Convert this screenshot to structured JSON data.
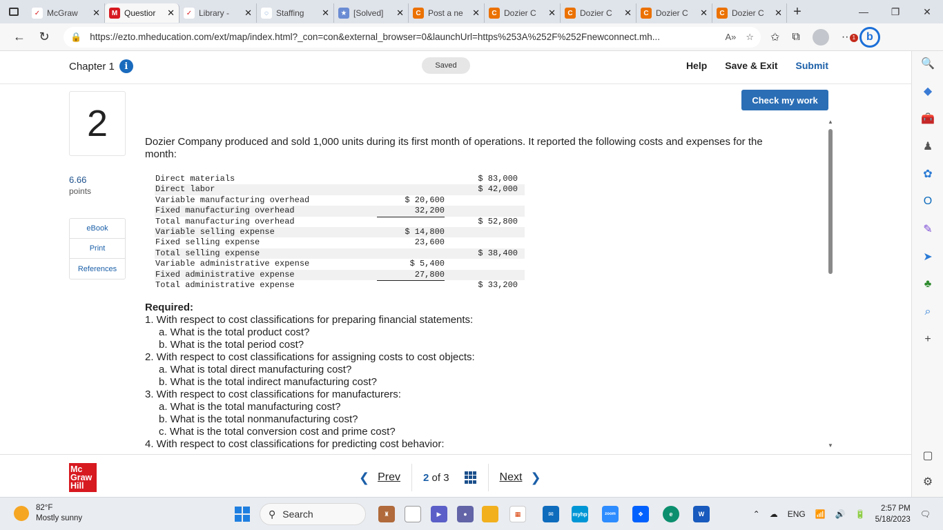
{
  "browser": {
    "tabs": [
      {
        "label": "McGraw",
        "favicon": "mcgraw-bird-icon",
        "active": false
      },
      {
        "label": "Questior",
        "favicon": "mheducation-m-icon",
        "active": true
      },
      {
        "label": "Library -",
        "favicon": "mcgraw-bird-icon",
        "active": false
      },
      {
        "label": "Staffing",
        "favicon": "loading-icon",
        "active": false
      },
      {
        "label": "[Solved]",
        "favicon": "star-icon",
        "active": false
      },
      {
        "label": "Post a ne",
        "favicon": "chegg-c-icon",
        "active": false
      },
      {
        "label": "Dozier C",
        "favicon": "chegg-c-icon",
        "active": false
      },
      {
        "label": "Dozier C",
        "favicon": "chegg-c-icon",
        "active": false
      },
      {
        "label": "Dozier C",
        "favicon": "chegg-c-icon",
        "active": false
      },
      {
        "label": "Dozier C",
        "favicon": "chegg-c-icon",
        "active": false
      }
    ],
    "url": "https://ezto.mheducation.com/ext/map/index.html?_con=con&external_browser=0&launchUrl=https%253A%252F%252Fnewconnect.mh...",
    "notification_count": "1"
  },
  "header": {
    "chapter": "Chapter 1",
    "saved": "Saved",
    "help": "Help",
    "save_exit": "Save & Exit",
    "submit": "Submit"
  },
  "question": {
    "number": "2",
    "points_value": "6.66",
    "points_label": "points",
    "side_buttons": [
      "eBook",
      "Print",
      "References"
    ],
    "check_button": "Check my work",
    "prompt": "Dozier Company produced and sold 1,000 units during its first month of operations. It reported the following costs and expenses for the month:",
    "cost_table": [
      {
        "label": "Direct materials",
        "c1": "",
        "c2": "$ 83,000",
        "ul": false
      },
      {
        "label": "Direct labor",
        "c1": "",
        "c2": "$ 42,000",
        "ul": false
      },
      {
        "label": "Variable manufacturing overhead",
        "c1": "$ 20,600",
        "c2": "",
        "ul": false
      },
      {
        "label": "Fixed manufacturing overhead",
        "c1": "32,200",
        "c2": "",
        "ul": true
      },
      {
        "label": "Total manufacturing overhead",
        "c1": "",
        "c2": "$ 52,800",
        "ul": false
      },
      {
        "label": "Variable selling expense",
        "c1": "$ 14,800",
        "c2": "",
        "ul": false
      },
      {
        "label": "Fixed selling expense",
        "c1": "23,600",
        "c2": "",
        "ul": true
      },
      {
        "label": "Total selling expense",
        "c1": "",
        "c2": "$ 38,400",
        "ul": false
      },
      {
        "label": "Variable administrative expense",
        "c1": "$ 5,400",
        "c2": "",
        "ul": false
      },
      {
        "label": "Fixed administrative expense",
        "c1": "27,800",
        "c2": "",
        "ul": true
      },
      {
        "label": "Total administrative expense",
        "c1": "",
        "c2": "$ 33,200",
        "ul": false
      }
    ],
    "required_title": "Required:",
    "required": [
      {
        "text": "1. With respect to cost classifications for preparing financial statements:",
        "level": 1
      },
      {
        "text": "a. What is the total product cost?",
        "level": 2
      },
      {
        "text": "b. What is the total period cost?",
        "level": 2
      },
      {
        "text": "2. With respect to cost classifications for assigning costs to cost objects:",
        "level": 1
      },
      {
        "text": "a. What is total direct manufacturing cost?",
        "level": 2
      },
      {
        "text": "b. What is the total indirect manufacturing cost?",
        "level": 2
      },
      {
        "text": "3. With respect to cost classifications for manufacturers:",
        "level": 1
      },
      {
        "text": "a. What is the total manufacturing cost?",
        "level": 2
      },
      {
        "text": "b. What is the total nonmanufacturing cost?",
        "level": 2
      },
      {
        "text": "c. What is the total conversion cost and prime cost?",
        "level": 2
      },
      {
        "text": "4. With respect to cost classifications for predicting cost behavior:",
        "level": 1
      }
    ]
  },
  "footer": {
    "logo_lines": [
      "Mc",
      "Graw",
      "Hill"
    ],
    "prev": "Prev",
    "current": "2",
    "of": "of",
    "total": "3",
    "next": "Next"
  },
  "taskbar": {
    "temp": "82°F",
    "weather": "Mostly sunny",
    "search": "Search",
    "lang": "ENG",
    "time": "2:57 PM",
    "date": "5/18/2023"
  },
  "colors": {
    "accent": "#2b6eb5",
    "link": "#1b5fa8",
    "brand_red": "#d71920",
    "chegg_orange": "#eb7100"
  }
}
